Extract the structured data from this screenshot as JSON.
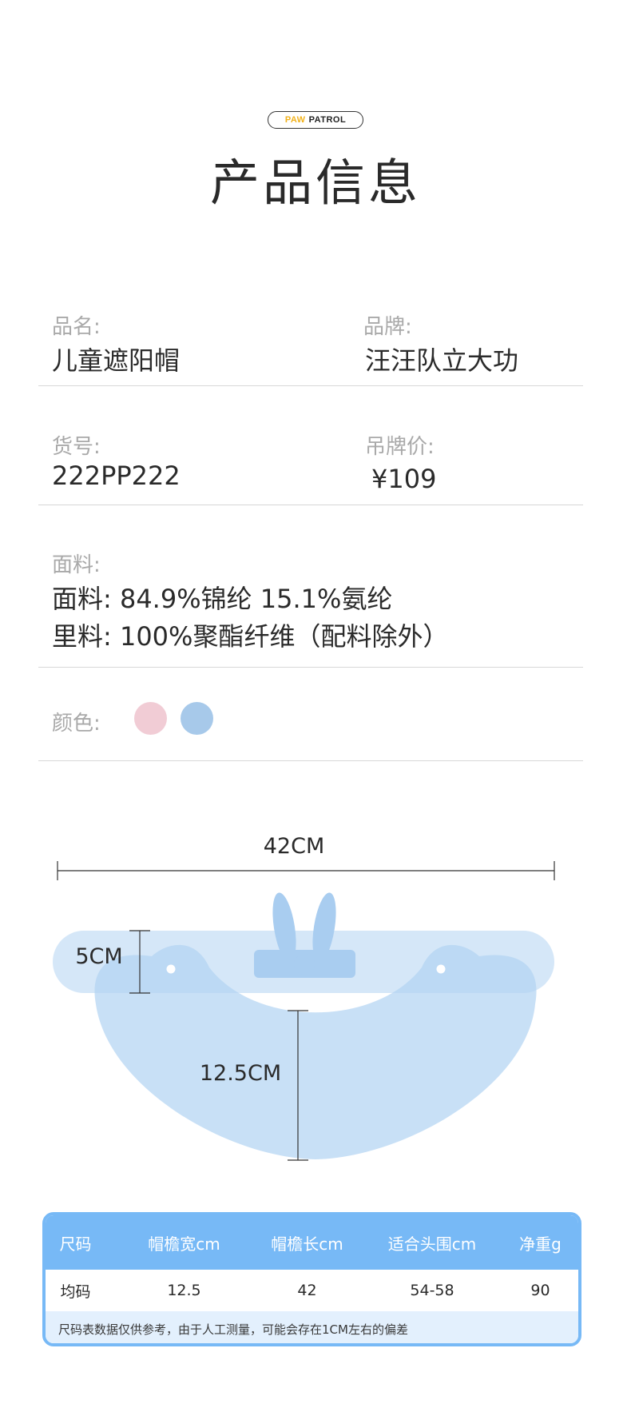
{
  "header": {
    "brand_paw": "PAW",
    "brand_patrol": "PATROL",
    "title": "产品信息"
  },
  "info": {
    "name_label": "品名:",
    "name_value": "儿童遮阳帽",
    "brand_label": "品牌:",
    "brand_value": "汪汪队立大功",
    "sku_label": "货号:",
    "sku_value": "222PP222",
    "price_label": "吊牌价:",
    "price_value": "¥109",
    "fabric_label": "面料:",
    "fabric_line1": "面料: 84.9%锦纶 15.1%氨纶",
    "fabric_line2": "里料: 100%聚酯纤维（配料除外）",
    "color_label": "颜色:",
    "colors": [
      "#f1ccd5",
      "#a7c9ea"
    ]
  },
  "diagram": {
    "width_label": "42CM",
    "band_label": "5CM",
    "brim_label": "12.5CM",
    "hat_fill": "#b3d4f3",
    "accent": "#a9cdf0"
  },
  "size_table": {
    "headers": [
      "尺码",
      "帽檐宽cm",
      "帽檐长cm",
      "适合头围cm",
      "净重g"
    ],
    "row": [
      "均码",
      "12.5",
      "42",
      "54-58",
      "90"
    ],
    "note": "尺码表数据仅供参考，由于人工测量，可能会存在1CM左右的偏差",
    "header_color": "#77b9f6",
    "note_bg": "#e3f0fd"
  }
}
